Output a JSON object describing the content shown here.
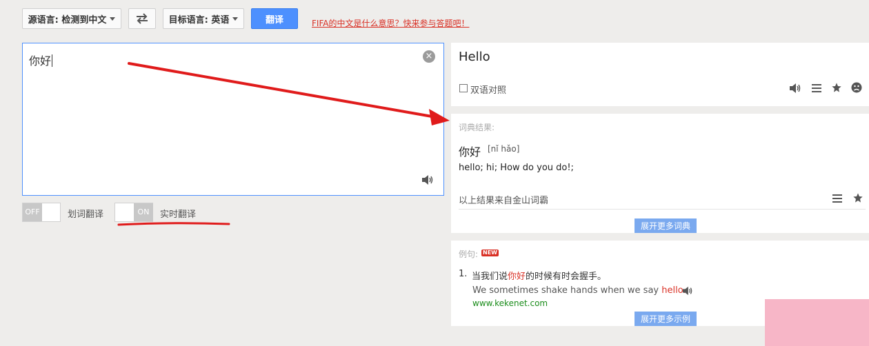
{
  "toolbar": {
    "source_lang_label": "源语言: 检测到中文",
    "swap_icon": "swap-arrows",
    "target_lang_label": "目标语言: 英语",
    "translate_label": "翻译",
    "promo_link": "FIFA的中文是什么意思？快来参与答题吧！"
  },
  "source": {
    "text": "你好",
    "clear_icon": "close-circle",
    "speaker_icon": "speaker"
  },
  "options": {
    "word_select": {
      "state": "OFF",
      "label": "划词翻译"
    },
    "realtime": {
      "state": "ON",
      "label": "实时翻译"
    }
  },
  "result": {
    "text": "Hello",
    "bilingual_label": "双语对照",
    "icons": [
      "speaker-icon",
      "list-icon",
      "star-icon",
      "sad-face-icon"
    ]
  },
  "dictionary": {
    "header": "词典结果:",
    "word": "你好",
    "pinyin": "[nǐ hǎo]",
    "definition": "hello; hi; How do you do!;",
    "source_note": "以上结果来自金山词霸",
    "more_button": "展开更多词典"
  },
  "examples": {
    "header": "例句:",
    "new_badge": "NEW",
    "items": [
      {
        "number": "1.",
        "zh_before": "当我们说",
        "zh_highlight": "你好",
        "zh_after": "的时候有时会握手。",
        "en_before": "We sometimes shake hands when we say ",
        "en_highlight": "hello.",
        "source": "www.kekenet.com"
      }
    ],
    "more_button": "展开更多示例"
  },
  "colors": {
    "accent_blue": "#4d90fe",
    "highlight_red": "#d93025",
    "link_green": "#1a8c1a",
    "annotation_red": "#e01b1b",
    "pink_block": "#f7b6c7"
  }
}
